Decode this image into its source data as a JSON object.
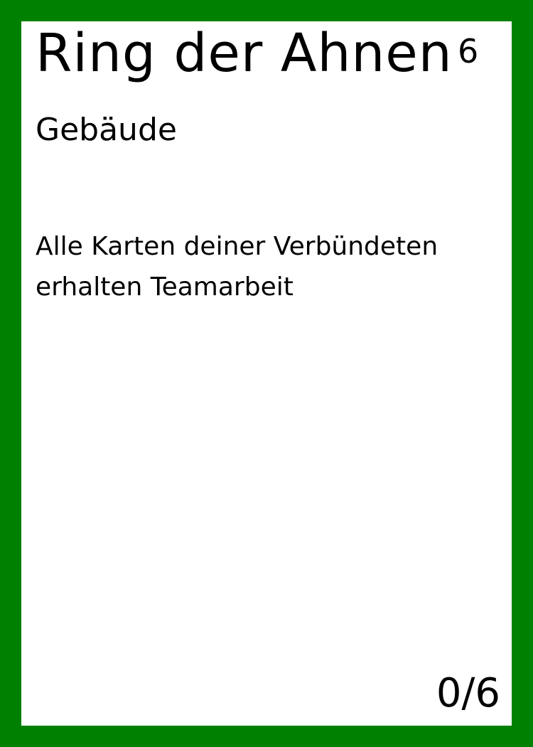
{
  "card": {
    "name": "Ring der Ahnen",
    "cost": "6",
    "type": "Gebäude",
    "text": "Alle Karten deiner Verbündeten erhalten Teamarbeit",
    "counter": "0/6"
  },
  "colors": {
    "border": "#008000",
    "background": "#ffffff",
    "text": "#000000"
  }
}
